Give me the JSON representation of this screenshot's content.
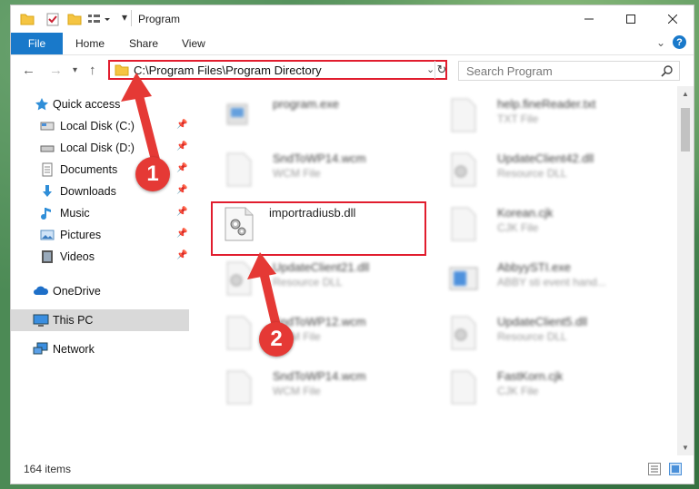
{
  "window": {
    "title": "Program"
  },
  "ribbon": {
    "file": "File",
    "home": "Home",
    "share": "Share",
    "view": "View"
  },
  "address": {
    "path": "C:\\Program Files\\Program Directory"
  },
  "search": {
    "placeholder": "Search Program"
  },
  "nav_pane": {
    "quick_access": "Quick access",
    "items": [
      {
        "label": "Local Disk (C:)",
        "icon": "drive-icon"
      },
      {
        "label": "Local Disk (D:)",
        "icon": "drive-icon"
      },
      {
        "label": "Documents",
        "icon": "documents-icon"
      },
      {
        "label": "Downloads",
        "icon": "downloads-icon"
      },
      {
        "label": "Music",
        "icon": "music-icon"
      },
      {
        "label": "Pictures",
        "icon": "pictures-icon"
      },
      {
        "label": "Videos",
        "icon": "videos-icon"
      }
    ],
    "onedrive": "OneDrive",
    "this_pc": "This PC",
    "network": "Network"
  },
  "files": [
    {
      "name": "program.exe",
      "type": ""
    },
    {
      "name": "help.fineReader.txt",
      "type": "TXT File"
    },
    {
      "name": "SndToWP14.wcm",
      "type": "WCM File"
    },
    {
      "name": "UpdateClient42.dll",
      "type": "Resource DLL"
    },
    {
      "name": "importradiusb.dll",
      "type": ""
    },
    {
      "name": "Korean.cjk",
      "type": "CJK File"
    },
    {
      "name": "UpdateClient21.dll",
      "type": "Resource DLL"
    },
    {
      "name": "AbbyySTI.exe",
      "type": "ABBY sti event hand..."
    },
    {
      "name": "SndToWP12.wcm",
      "type": "WCM File"
    },
    {
      "name": "UpdateClient5.dll",
      "type": "Resource DLL"
    },
    {
      "name": "SndToWP14.wcm",
      "type": "WCM File"
    },
    {
      "name": "FastKorn.cjk",
      "type": "CJK File"
    }
  ],
  "status": {
    "count": "164 items"
  },
  "annotations": {
    "step1": "1",
    "step2": "2"
  },
  "colors": {
    "accent": "#1979ca",
    "highlight": "#e11d2e"
  }
}
